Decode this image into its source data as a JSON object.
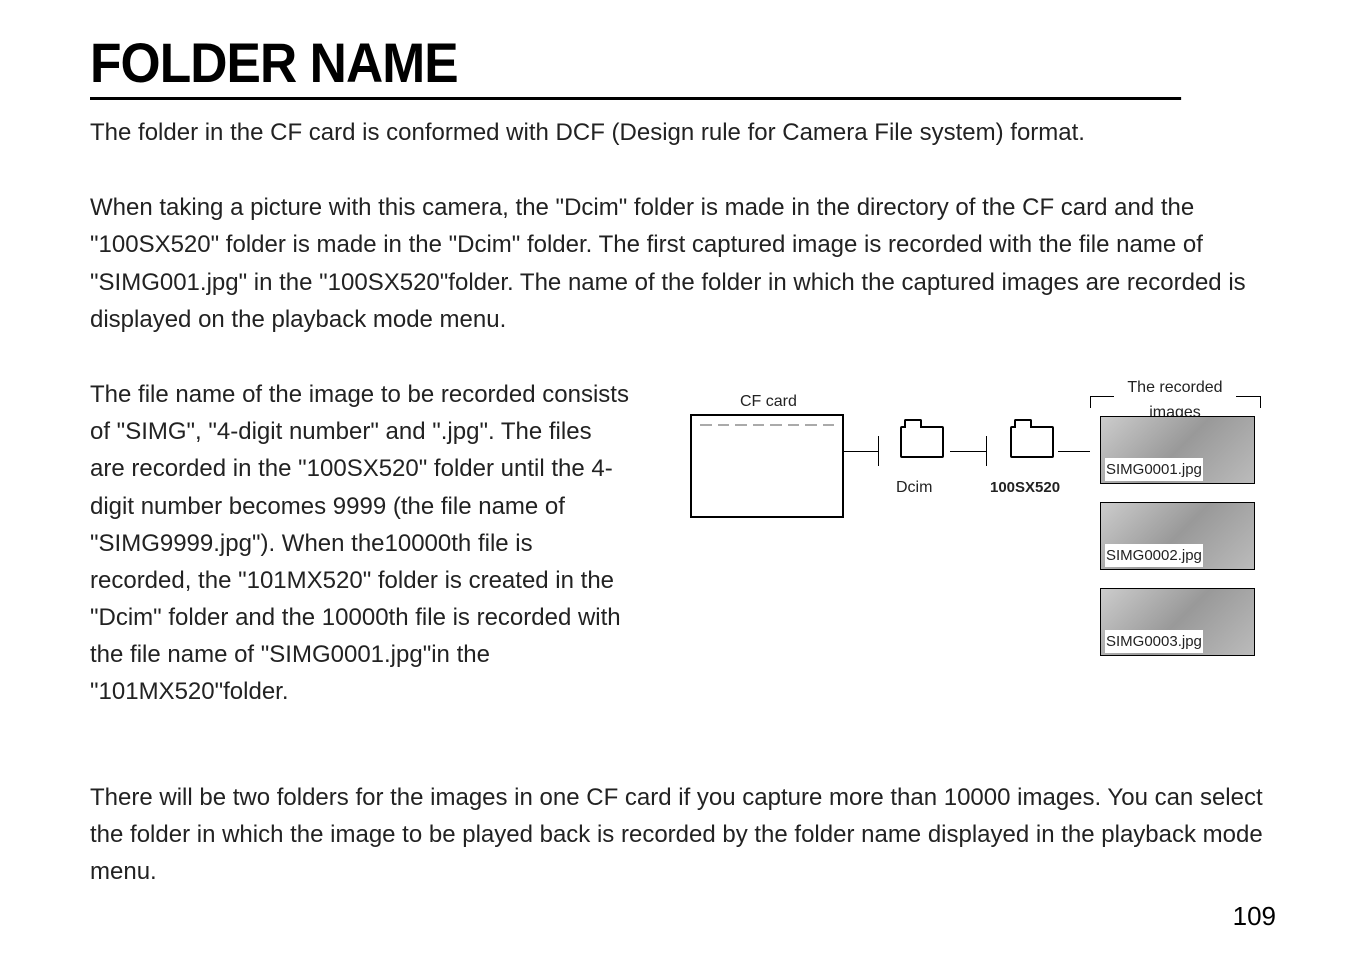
{
  "title": "FOLDER NAME",
  "p1": "The folder in the CF card is conformed with DCF (Design rule for Camera File system) format.",
  "p2": "When taking a picture with this camera, the \"Dcim\" folder is made in the directory of the CF card and the \"100SX520\" folder is made in the \"Dcim\" folder. The first captured image is recorded with the file name of \"SIMG001.jpg\" in the \"100SX520\"folder. The name of the folder in which the captured images are recorded is displayed on the playback mode menu.",
  "p3": "The file name of the image to be recorded consists of \"SIMG\", \"4-digit number\" and \".jpg\". The files are recorded in the \"100SX520\" folder until the 4-digit number becomes 9999 (the file name of \"SIMG9999.jpg\"). When the10000th file is recorded, the \"101MX520\" folder is created in the \"Dcim\" folder and the 10000th file is recorded with the file name of \"SIMG0001.jpg\"in the \"101MX520\"folder.",
  "p4": "There will be two folders for the images in one CF card if you capture more than 10000 images. You can select the folder in which the image to be played back is recorded by the folder name displayed in the playback mode menu.",
  "diagram": {
    "cf_label": "CF card",
    "dcim_label": "Dcim",
    "sx_label": "100SX520",
    "recorded_label": "The recorded images",
    "thumbs": [
      "SIMG0001.jpg",
      "SIMG0002.jpg",
      "SIMG0003.jpg"
    ]
  },
  "page_number": "109"
}
